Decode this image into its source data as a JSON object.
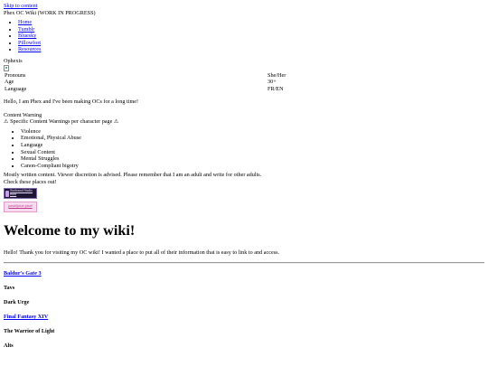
{
  "skip_link": "Skip to content",
  "site_title": "Phex OC Wiki (WORK IN PROGRESS)",
  "nav": {
    "home": "Home",
    "tumblr": "Tumblr",
    "bluesky": "Bluesky",
    "pillowfort": "Pillowfort",
    "resources": "Resources"
  },
  "character_name": "Ophexis",
  "info": {
    "pronouns_label": "Pronouns",
    "pronouns_value": "She/Her",
    "age_label": "Age",
    "age_value": "30+",
    "language_label": "Language",
    "language_value": "FR/EN"
  },
  "intro": "Hello, I am Phex and I've been making OCs for a long time!",
  "content_warning": {
    "title": "Content Warning",
    "subtitle": "⚠ Specific Content Warnings per character page ⚠",
    "items": [
      "Violence",
      "Emotional, Physical Abuse",
      "Language",
      "Sexual Content",
      "Mental Struggles",
      "Canon-Compliant bigotry"
    ]
  },
  "disclaimer": "Mostly written content. Viewer discretion is advised. Please remember that I am an adult and write for other adults.",
  "check_places": "Check these places out!",
  "buttons": {
    "button1_text": "Starbound Studio Burn",
    "button2_text": "pastelpixie pixel"
  },
  "welcome": {
    "heading": "Welcome to my wiki!",
    "text": "Hello! Thank you for visiting my OC wiki! I wanted a place to put all of their information that is easy to link to and access."
  },
  "sections": {
    "bg3": "Baldur's Gate 3",
    "tavs": "Tavs",
    "dark_urge": "Dark Urge",
    "ffxiv": "Final Fantasy XIV",
    "warrior": "The Warrior of Light",
    "alts": "Alts"
  },
  "colors": {
    "link": "#0000ee",
    "button1_bg": "#1e1433",
    "button2_bg": "#f7dcef"
  }
}
